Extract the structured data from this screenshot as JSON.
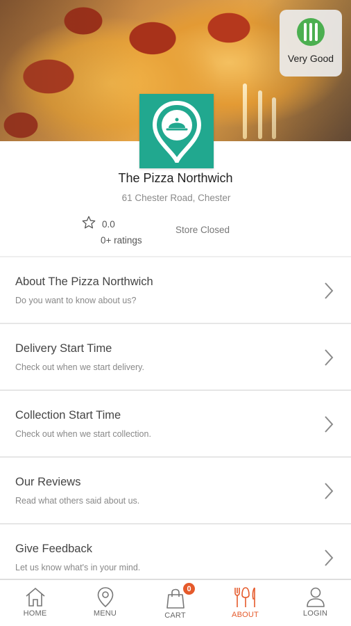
{
  "hygiene": {
    "label": "Very Good"
  },
  "store": {
    "name": "The Pizza Northwich",
    "address": "61 Chester Road, Chester",
    "rating": "0.0",
    "ratings_count": "0+ ratings",
    "status": "Store Closed"
  },
  "menu_items": [
    {
      "title": "About The Pizza Northwich",
      "subtitle": "Do you want to know about us?"
    },
    {
      "title": "Delivery Start Time",
      "subtitle": "Check out when we start delivery."
    },
    {
      "title": "Collection Start Time",
      "subtitle": "Check out when we start collection."
    },
    {
      "title": "Our Reviews",
      "subtitle": "Read what others said about us."
    },
    {
      "title": "Give Feedback",
      "subtitle": "Let us know what's in your mind."
    }
  ],
  "nav": {
    "items": [
      {
        "label": "HOME",
        "icon": "home-icon"
      },
      {
        "label": "MENU",
        "icon": "location-pin-icon"
      },
      {
        "label": "CART",
        "icon": "shopping-bag-icon",
        "badge": "0"
      },
      {
        "label": "ABOUT",
        "icon": "cutlery-icon",
        "active": true
      },
      {
        "label": "LOGIN",
        "icon": "user-icon"
      }
    ],
    "active_color": "#e55a2b"
  },
  "colors": {
    "brand": "#21a88f",
    "accent": "#e55a2b",
    "hygiene_green": "#4caf50"
  }
}
